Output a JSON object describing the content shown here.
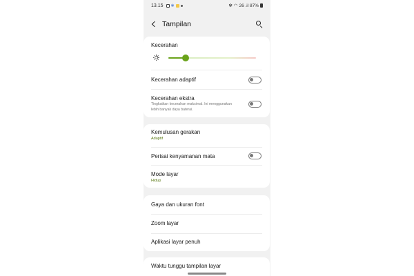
{
  "status_bar": {
    "time": "13.15",
    "right_text": "26 .il 87%"
  },
  "header": {
    "title": "Tampilan",
    "back_icon": "chevron-left-icon",
    "search_icon": "search-icon"
  },
  "brightness": {
    "label": "Kecerahan",
    "level_percent": 20,
    "icon": "sun-icon",
    "fill_color": "#6aa31a"
  },
  "settings": [
    {
      "label": "Kecerahan adaptif",
      "toggle": false
    },
    {
      "label": "Kecerahan ekstra",
      "description": "Tingkatkan kecerahan maksimal. Ini menggunakan lebih banyak daya baterai.",
      "toggle": false
    },
    {
      "label": "Kemulusan gerakan",
      "sub": "Adaptif"
    },
    {
      "label": "Perisai kenyamanan mata",
      "toggle": false
    },
    {
      "label": "Mode layar",
      "sub": "Hidup"
    },
    {
      "label": "Gaya dan ukuran font"
    },
    {
      "label": "Zoom layar"
    },
    {
      "label": "Aplikasi layar penuh"
    },
    {
      "label": "Waktu tunggu tampilan layar"
    }
  ],
  "colors": {
    "accent": "#6aa31a",
    "sub_text": "#5b7a14",
    "background": "#f1f1f1",
    "card": "#ffffff"
  }
}
